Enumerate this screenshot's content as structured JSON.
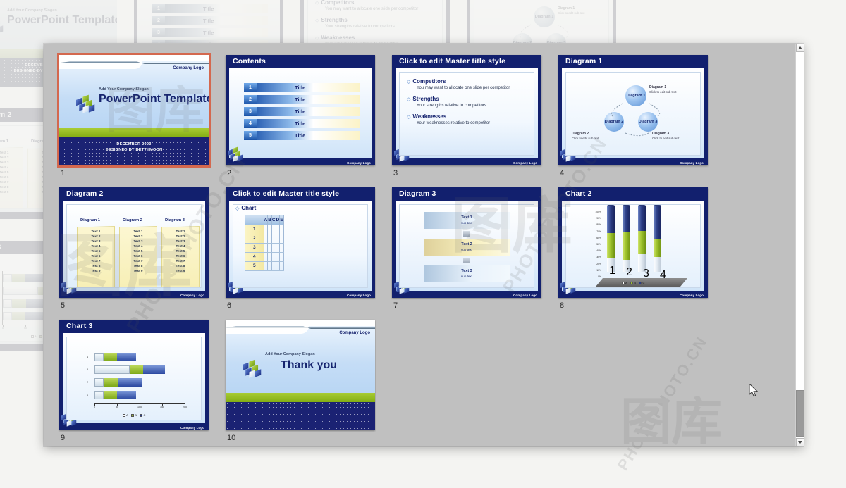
{
  "window": {
    "type": "powerpoint-slide-sorter",
    "scrollbar": {
      "up_arrow": "▲",
      "down_arrow": "▼"
    }
  },
  "common": {
    "company_logo": "Company Logo",
    "slogan": "Add Your Company Slogan"
  },
  "slides": [
    {
      "number": "1",
      "kind": "title",
      "selected": true,
      "company_logo": "Company Logo",
      "slogan": "Add Your Company Slogan",
      "main_title": "PowerPoint Template",
      "date": "DECEMBER 2003",
      "designed_by": "DESIGNED BY BETTYMOON"
    },
    {
      "number": "2",
      "kind": "contents",
      "title": "Contents",
      "rows": [
        {
          "num": "1",
          "label": "Title"
        },
        {
          "num": "2",
          "label": "Title"
        },
        {
          "num": "3",
          "label": "Title"
        },
        {
          "num": "4",
          "label": "Title"
        },
        {
          "num": "5",
          "label": "Title"
        }
      ],
      "company_logo": "Company Logo"
    },
    {
      "number": "3",
      "kind": "bullets",
      "title": "Click to edit Master title style",
      "bullets": [
        {
          "head": "Competitors",
          "sub": "You may want to allocate one slide per competitor"
        },
        {
          "head": "Strengths",
          "sub": "Your strengths relative to competitors"
        },
        {
          "head": "Weaknesses",
          "sub": "Your weaknesses relative to competitor"
        }
      ],
      "company_logo": "Company Logo"
    },
    {
      "number": "4",
      "kind": "diagram1",
      "title": "Diagram 1",
      "circles": [
        {
          "label": "Diagram 1"
        },
        {
          "label": "Diagram 2"
        },
        {
          "label": "Diagram 3"
        }
      ],
      "captions": [
        {
          "head": "Diagram 1",
          "sub": "Click to edit sub text"
        },
        {
          "head": "Diagram 2",
          "sub": "Click to edit sub text"
        },
        {
          "head": "Diagram 3",
          "sub": "Click to edit sub text"
        }
      ],
      "company_logo": "Company Logo"
    },
    {
      "number": "5",
      "kind": "diagram2",
      "title": "Diagram 2",
      "columns": [
        {
          "head": "Diagram 1",
          "items": [
            "Text 1",
            "Text 2",
            "Text 3",
            "Text 4",
            "Text 5",
            "Text 6",
            "Text 7",
            "Text 8",
            "Text 9"
          ]
        },
        {
          "head": "Diagram 2",
          "items": [
            "Text 1",
            "Text 2",
            "Text 3",
            "Text 4",
            "Text 5",
            "Text 6",
            "Text 7",
            "Text 8",
            "Text 9"
          ]
        },
        {
          "head": "Diagram 3",
          "items": [
            "Text 1",
            "Text 2",
            "Text 3",
            "Text 4",
            "Text 5",
            "Text 6",
            "Text 7",
            "Text 8",
            "Text 9"
          ]
        }
      ],
      "company_logo": "Company Logo"
    },
    {
      "number": "6",
      "kind": "table",
      "title": "Click to edit Master title style",
      "section": "Chart",
      "columns": [
        "",
        "A",
        "B",
        "C",
        "D",
        "E"
      ],
      "rows": [
        "1",
        "2",
        "3",
        "4",
        "5"
      ],
      "company_logo": "Company Logo"
    },
    {
      "number": "7",
      "kind": "diagram3",
      "title": "Diagram 3",
      "bands": [
        {
          "head": "Text 1",
          "sub": "sub text",
          "tone": "blue"
        },
        {
          "head": "Text 2",
          "sub": "sub text",
          "tone": "gold"
        },
        {
          "head": "Text 3",
          "sub": "sub text",
          "tone": "blue"
        }
      ],
      "company_logo": "Company Logo"
    },
    {
      "number": "8",
      "kind": "chart2",
      "title": "Chart 2",
      "company_logo": "Company Logo"
    },
    {
      "number": "9",
      "kind": "chart3",
      "title": "Chart 3",
      "company_logo": "Company Logo"
    },
    {
      "number": "10",
      "kind": "title",
      "selected": false,
      "company_logo": "Company Logo",
      "slogan": "Add Your Company Slogan",
      "main_title": "Thank you",
      "date": "",
      "designed_by": ""
    }
  ],
  "chart_data": [
    {
      "type": "bar",
      "orientation": "vertical-stacked-3d",
      "slide": "8",
      "title": "Chart 2",
      "categories": [
        "1",
        "2",
        "3",
        "4"
      ],
      "series": [
        {
          "name": "A",
          "values": [
            20,
            18,
            28,
            22
          ],
          "color": "#ffffff"
        },
        {
          "name": "B",
          "values": [
            38,
            42,
            34,
            28
          ],
          "color": "#9dc22c"
        },
        {
          "name": "C",
          "values": [
            42,
            40,
            38,
            50
          ],
          "color": "#2c3e86"
        }
      ],
      "ylabel": "",
      "xlabel": "",
      "ylim": [
        0,
        100
      ],
      "yticks": [
        "0%",
        "10%",
        "20%",
        "30%",
        "40%",
        "50%",
        "60%",
        "70%",
        "80%",
        "90%",
        "100%"
      ],
      "legend": [
        "A",
        "B",
        "C"
      ],
      "legend_position": "bottom",
      "grid": false
    },
    {
      "type": "bar",
      "orientation": "horizontal-stacked",
      "slide": "9",
      "title": "Chart 3",
      "categories": [
        "1",
        "2",
        "3",
        "4"
      ],
      "series": [
        {
          "name": "A",
          "values": [
            20,
            20,
            78,
            20
          ],
          "color": "#dfe9f2"
        },
        {
          "name": "B",
          "values": [
            30,
            32,
            30,
            30
          ],
          "color": "#9dc22c"
        },
        {
          "name": "C",
          "values": [
            42,
            52,
            48,
            42
          ],
          "color": "#2b48a0"
        }
      ],
      "ylabel": "",
      "xlabel": "",
      "xlim": [
        0,
        200
      ],
      "xticks": [
        "0",
        "50",
        "100",
        "150",
        "200"
      ],
      "legend": [
        "A",
        "B",
        "C"
      ],
      "legend_position": "bottom",
      "grid": false
    }
  ],
  "watermark": {
    "text": "PHOTOPHOTO.CN",
    "glyph": "图库"
  }
}
